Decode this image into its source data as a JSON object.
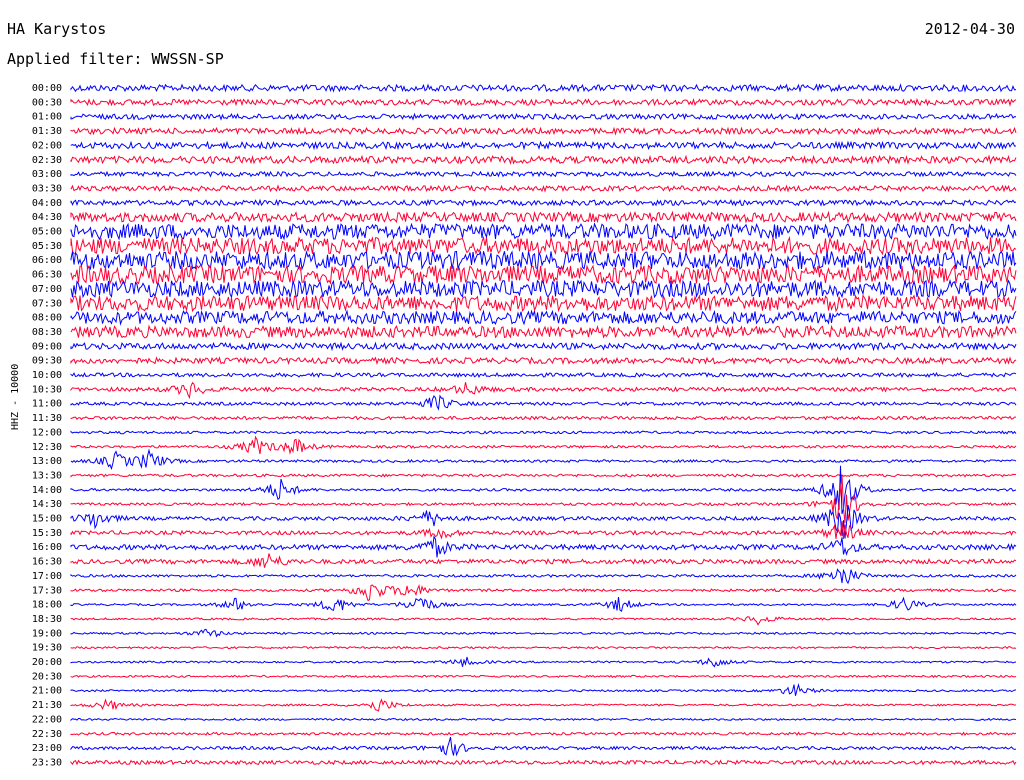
{
  "header": {
    "station": "HA Karystos",
    "date": "2012-04-30",
    "filter": "Applied filter: WWSSN-SP",
    "channel": "HHZ - 10000"
  },
  "colors": {
    "traceA": "#0000ff",
    "traceB": "#ff0033",
    "background": "#ffffff",
    "text": "#000000"
  },
  "chart_data": {
    "type": "helicorder",
    "tick_labels": [
      "00:00",
      "00:30",
      "01:00",
      "01:30",
      "02:00",
      "02:30",
      "03:00",
      "03:30",
      "04:00",
      "04:30",
      "05:00",
      "05:30",
      "06:00",
      "06:30",
      "07:00",
      "07:30",
      "08:00",
      "08:30",
      "09:00",
      "09:30",
      "10:00",
      "10:30",
      "11:00",
      "11:30",
      "12:00",
      "12:30",
      "13:00",
      "13:30",
      "14:00",
      "14:30",
      "15:00",
      "15:30",
      "16:00",
      "16:30",
      "17:00",
      "17:30",
      "18:00",
      "18:30",
      "19:00",
      "19:30",
      "20:00",
      "20:30",
      "21:00",
      "21:30",
      "22:00",
      "22:30",
      "23:00",
      "23:30"
    ],
    "line_colors": [
      "blue",
      "red"
    ],
    "relative_noise_amplitude": [
      1.0,
      0.9,
      0.8,
      0.9,
      1.0,
      1.1,
      0.7,
      0.8,
      0.8,
      1.5,
      2.4,
      2.6,
      2.8,
      2.8,
      2.6,
      2.4,
      2.0,
      1.8,
      1.0,
      0.9,
      0.6,
      0.6,
      0.5,
      0.5,
      0.4,
      0.4,
      0.4,
      0.4,
      0.4,
      0.4,
      0.6,
      0.6,
      0.8,
      0.7,
      0.4,
      0.4,
      0.3,
      0.3,
      0.3,
      0.3,
      0.3,
      0.3,
      0.3,
      0.3,
      0.3,
      0.4,
      0.5,
      0.6
    ]
  }
}
